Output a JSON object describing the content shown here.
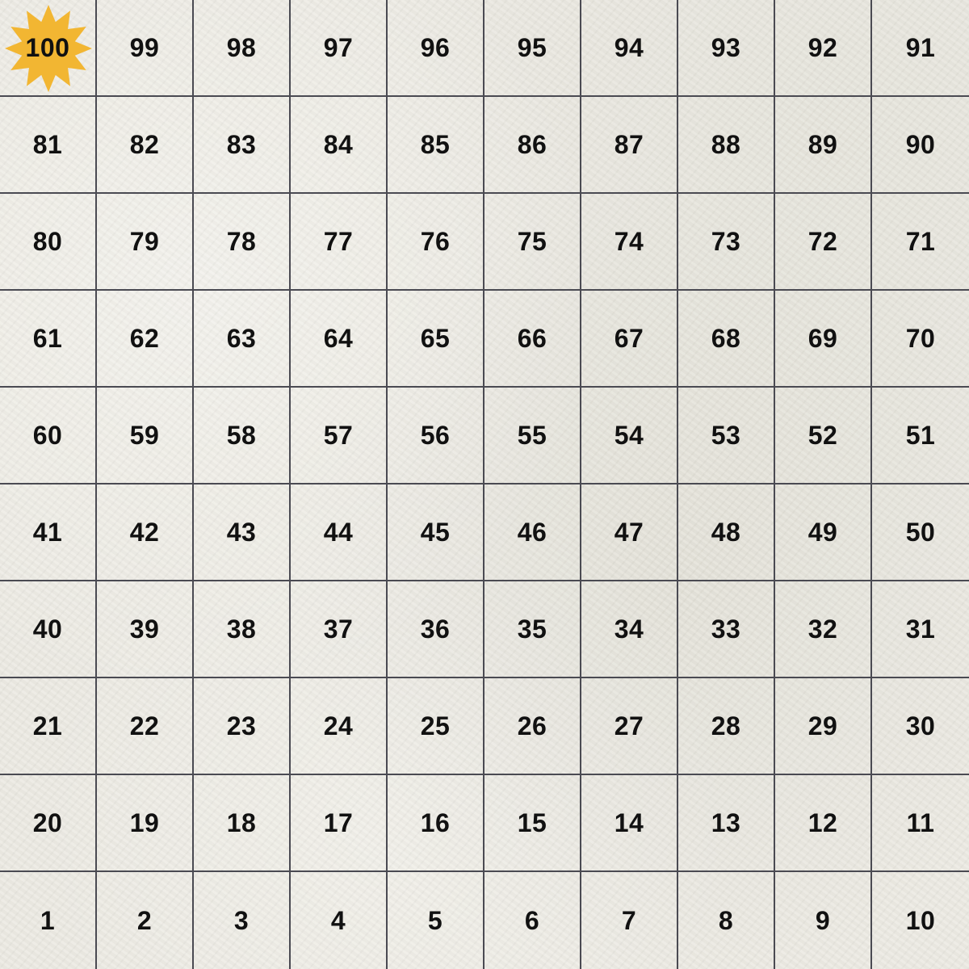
{
  "board": {
    "rows": [
      [
        100,
        99,
        98,
        97,
        96,
        95,
        94,
        93,
        92,
        91
      ],
      [
        81,
        82,
        83,
        84,
        85,
        86,
        87,
        88,
        89,
        90
      ],
      [
        80,
        79,
        78,
        77,
        76,
        75,
        74,
        73,
        72,
        71
      ],
      [
        61,
        62,
        63,
        64,
        65,
        66,
        67,
        68,
        69,
        70
      ],
      [
        60,
        59,
        58,
        57,
        56,
        55,
        54,
        53,
        52,
        51
      ],
      [
        41,
        42,
        43,
        44,
        45,
        46,
        47,
        48,
        49,
        50
      ],
      [
        40,
        39,
        38,
        37,
        36,
        35,
        34,
        33,
        32,
        31
      ],
      [
        21,
        22,
        23,
        24,
        25,
        26,
        27,
        28,
        29,
        30
      ],
      [
        20,
        19,
        18,
        17,
        16,
        15,
        14,
        13,
        12,
        11
      ],
      [
        1,
        2,
        3,
        4,
        5,
        6,
        7,
        8,
        9,
        10
      ]
    ],
    "goal_square": 100,
    "goal_marker_icon": "star-icon",
    "colors": {
      "background": "#ebe9e1",
      "grid_line": "#4a4a52",
      "number": "#111111",
      "goal_star": "#f2b632"
    }
  }
}
